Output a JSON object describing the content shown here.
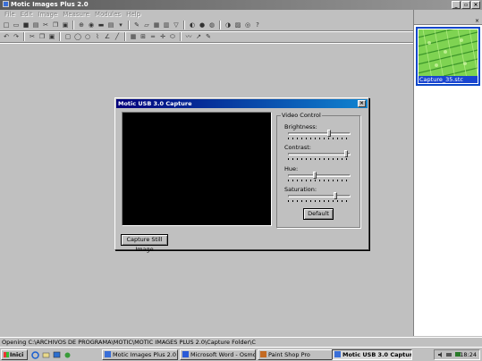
{
  "app": {
    "title": "Motic Images Plus 2.0",
    "window_buttons": {
      "minimize": "_",
      "restore": "▫",
      "close": "×"
    }
  },
  "menu": [
    "File",
    "Edit",
    "Image",
    "Measure",
    "Modules",
    "Help"
  ],
  "toolbar1": [
    "new-file-icon",
    "open-folder-icon",
    "save-icon",
    "print-icon",
    "cut-icon",
    "copy-icon",
    "paste-icon",
    "zoom-icon",
    "camera-icon",
    "scanner-icon",
    "printer2-icon",
    "capture-dropdown-icon",
    "brush-icon",
    "eraser-icon",
    "image-icon",
    "histogram-icon",
    "filter-icon",
    "adjust-icon",
    "color-icon",
    "wheel-icon",
    "contrast-icon",
    "chart-icon",
    "globe-icon",
    "help-icon"
  ],
  "toolbar2": [
    "undo-icon",
    "redo-icon",
    "scissors-icon",
    "copy2-icon",
    "paste2-icon",
    "rect-select-icon",
    "ellipse-select-icon",
    "circle-icon",
    "measure-icon",
    "angle-icon",
    "line-icon",
    "grid-icon",
    "calibrate-icon",
    "ruler-icon",
    "crosshair-icon",
    "ellipse2-icon",
    "freehand-icon",
    "arrow-icon",
    "pen-icon"
  ],
  "right_panel": {
    "close": "×",
    "thumbnail_label": "Capture_35.stc"
  },
  "dialog": {
    "title": "Motic USB 3.0 Capture",
    "close": "×",
    "group_title": "Video Control",
    "sliders": [
      {
        "label": "Brightness:",
        "value": 0.66
      },
      {
        "label": "Contrast:",
        "value": 0.95
      },
      {
        "label": "Hue:",
        "value": 0.42
      },
      {
        "label": "Saturation:",
        "value": 0.78
      }
    ],
    "default_button": "Default",
    "capture_button": "Capture Still Image"
  },
  "status": {
    "text": "Opening C:\\ARCHIVOS DE PROGRAMA\\MOTIC\\MOTIC IMAGES PLUS 2.0\\Capture Folder\\C"
  },
  "taskbar": {
    "start_label": "Inici",
    "buttons": [
      {
        "label": "Motic Images Plus 2.0",
        "icon_color": "#3a6fd8",
        "active": false
      },
      {
        "label": "Microsoft Word - Osmosi.doc",
        "icon_color": "#2a5bd7",
        "active": false
      },
      {
        "label": "Paint Shop Pro",
        "icon_color": "#c46a22",
        "active": false
      },
      {
        "label": "Motic USB 3.0 Capture",
        "icon_color": "#3a6fd8",
        "active": true
      }
    ],
    "clock": "18:24"
  },
  "colors": {
    "dialog_title_start": "#00007b",
    "dialog_title_end": "#1084d0",
    "thumb_selection": "#0a46c8",
    "preview_bg": "#000000"
  }
}
